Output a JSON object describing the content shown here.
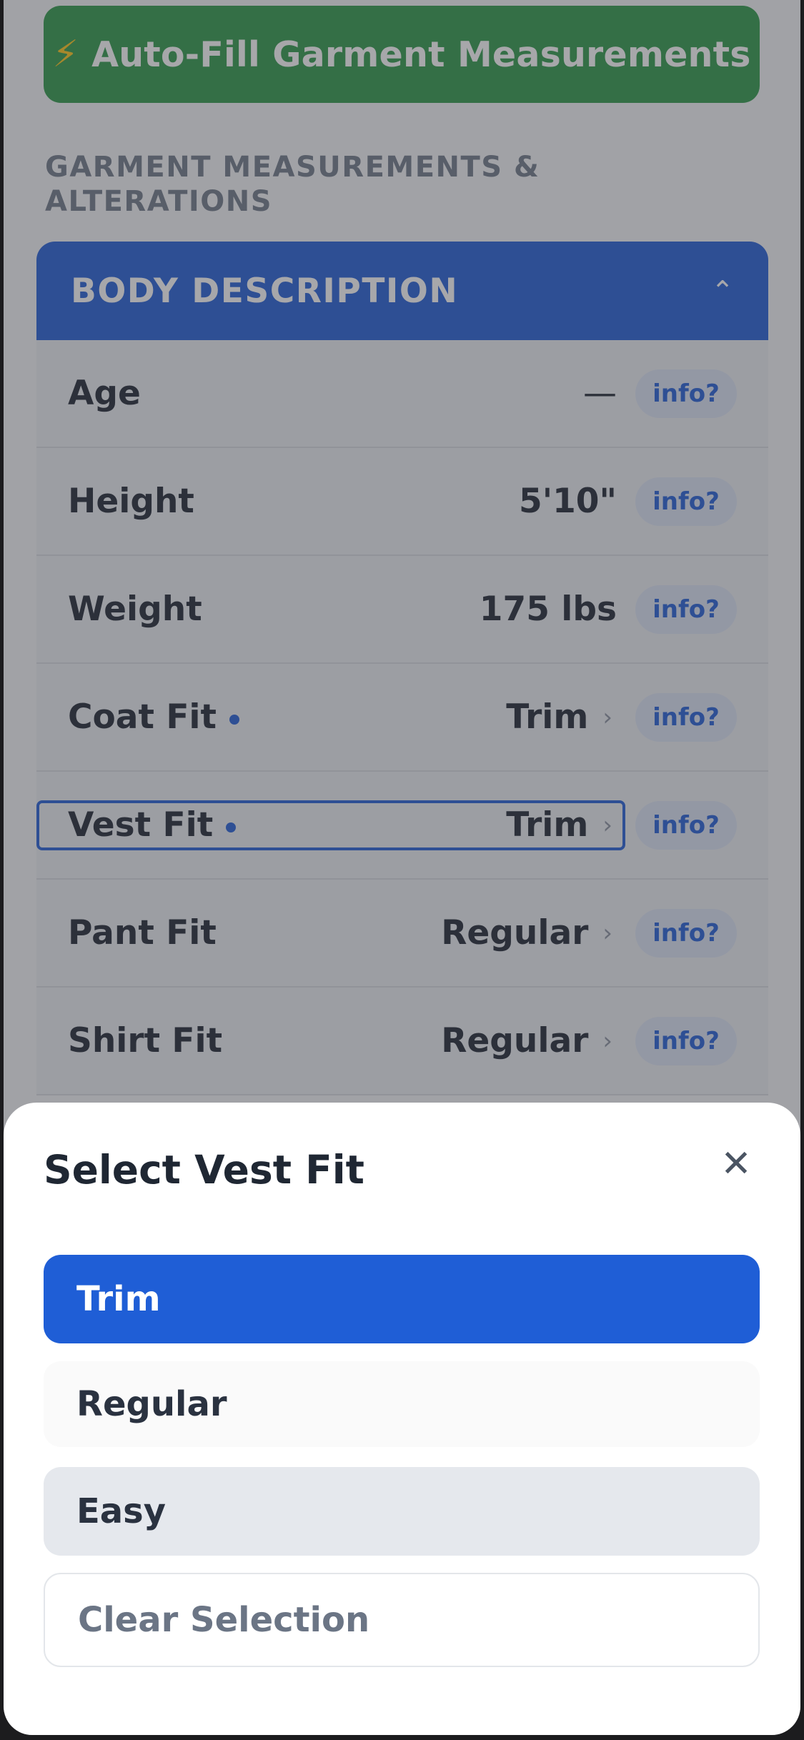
{
  "autofill_button": {
    "icon": "lightning-bolt-icon",
    "label": "Auto-Fill Garment Measurements"
  },
  "section_title": "GARMENT MEASUREMENTS & ALTERATIONS",
  "panel": {
    "title": "BODY DESCRIPTION",
    "rows": [
      {
        "label": "Age",
        "value": "—",
        "has_dot": false,
        "has_arrow": false,
        "info": "info?"
      },
      {
        "label": "Height",
        "value": "5'10\"",
        "has_dot": false,
        "has_arrow": false,
        "info": "info?"
      },
      {
        "label": "Weight",
        "value": "175 lbs",
        "has_dot": false,
        "has_arrow": false,
        "info": "info?"
      },
      {
        "label": "Coat Fit",
        "value": "Trim",
        "has_dot": true,
        "has_arrow": true,
        "info": "info?"
      },
      {
        "label": "Vest Fit",
        "value": "Trim",
        "has_dot": true,
        "has_arrow": true,
        "info": "info?"
      },
      {
        "label": "Pant Fit",
        "value": "Regular",
        "has_dot": false,
        "has_arrow": true,
        "info": "info?"
      },
      {
        "label": "Shirt Fit",
        "value": "Regular",
        "has_dot": false,
        "has_arrow": true,
        "info": "info?"
      }
    ]
  },
  "sheet": {
    "title": "Select Vest Fit",
    "close_icon": "close-icon",
    "options": [
      "Trim",
      "Regular",
      "Easy"
    ],
    "selected": "Trim",
    "clear_label": "Clear Selection"
  },
  "colors": {
    "primary": "#2360d8",
    "green": "#2f9a49",
    "info_bg": "#dbe4f5"
  }
}
